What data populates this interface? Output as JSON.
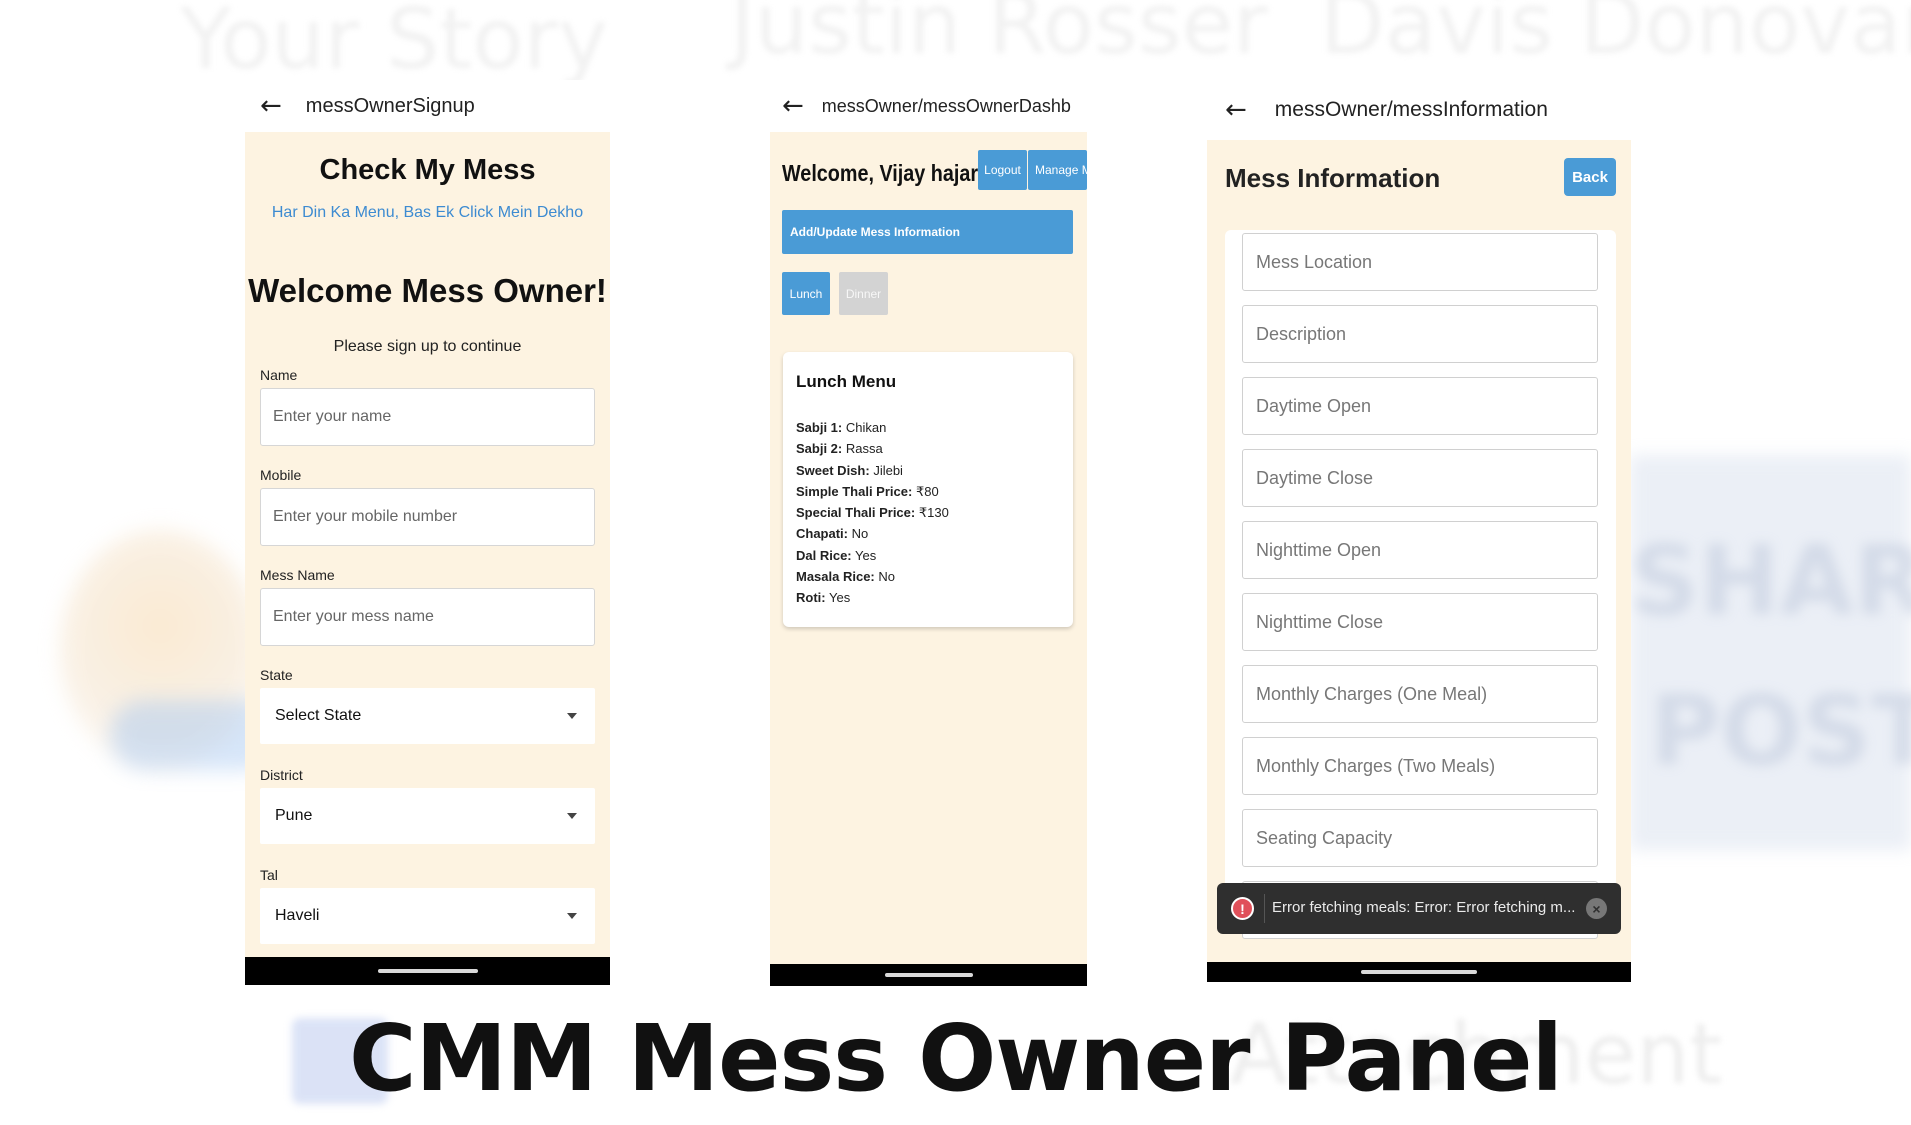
{
  "background": {
    "texts": [
      "Your Story",
      "Justin Rosser",
      "Davis Donovan",
      "SHARE",
      "POST",
      "Attachment"
    ]
  },
  "screen1": {
    "route": "messOwnerSignup",
    "brand": "Check My Mess",
    "tagline": "Har Din Ka Menu, Bas Ek Click Mein Dekho",
    "welcome": "Welcome Mess Owner!",
    "subtitle": "Please sign up to continue",
    "fields": [
      {
        "label": "Name",
        "placeholder": "Enter your name"
      },
      {
        "label": "Mobile",
        "placeholder": "Enter your mobile number"
      },
      {
        "label": "Mess Name",
        "placeholder": "Enter your mess name"
      }
    ],
    "selects": [
      {
        "label": "State",
        "value": "Select State"
      },
      {
        "label": "District",
        "value": "Pune"
      },
      {
        "label": "Tal",
        "value": "Haveli"
      }
    ]
  },
  "screen2": {
    "route": "messOwner/messOwnerDashb...",
    "welcome": "Welcome, Vijay hajare",
    "logout": "Logout",
    "manage": "Manage M",
    "add_update": "Add/Update Mess Information",
    "lunch": "Lunch",
    "dinner": "Dinner",
    "menu_title": "Lunch Menu",
    "menu_items": [
      {
        "key": "Sabji 1:",
        "value": "Chikan"
      },
      {
        "key": "Sabji 2:",
        "value": "Rassa"
      },
      {
        "key": "Sweet Dish:",
        "value": "Jilebi"
      },
      {
        "key": "Simple Thali Price:",
        "value": "₹80"
      },
      {
        "key": "Special Thali Price:",
        "value": "₹130"
      },
      {
        "key": "Chapati:",
        "value": "No"
      },
      {
        "key": "Dal Rice:",
        "value": "Yes"
      },
      {
        "key": "Masala Rice:",
        "value": "No"
      },
      {
        "key": "Roti:",
        "value": "Yes"
      }
    ]
  },
  "screen3": {
    "route": "messOwner/messInformation",
    "title": "Mess Information",
    "back": "Back",
    "fields": [
      "Mess Location",
      "Description",
      "Daytime Open",
      "Daytime Close",
      "Nighttime Open",
      "Nighttime Close",
      "Monthly Charges (One Meal)",
      "Monthly Charges (Two Meals)",
      "Seating Capacity"
    ],
    "toast": "Error fetching meals: Error: Error fetching m..."
  },
  "caption": "CMM Mess Owner Panel",
  "colors": {
    "app_bg": "#fdf3e1",
    "accent_blue": "#4a9bd6",
    "tagline_blue": "#3d8bd1",
    "toast_bg": "#2f2f2f",
    "error_red": "#e0505a"
  }
}
